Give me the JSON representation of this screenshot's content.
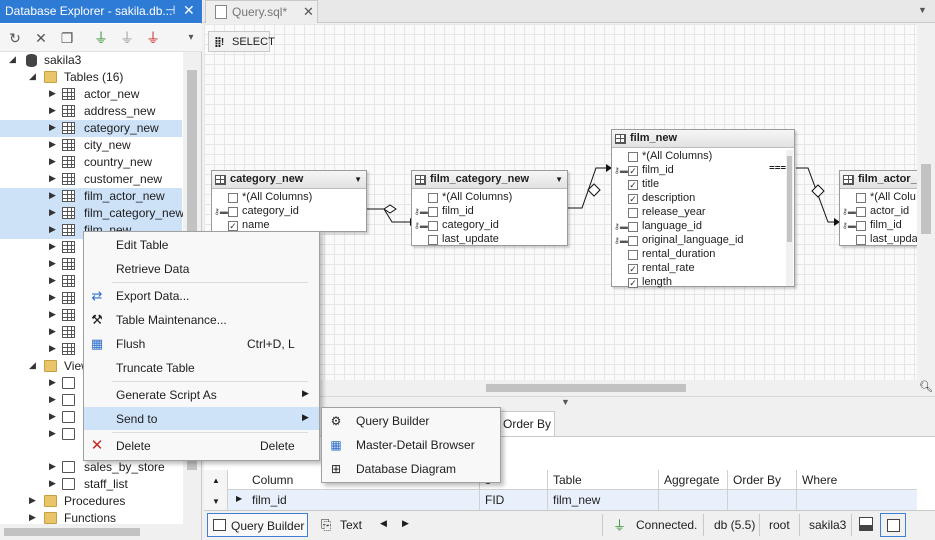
{
  "left_panel": {
    "title": "Database Explorer - sakila.db...",
    "pin_glyph": "⊣",
    "close_glyph": "✕",
    "database": "sakila3",
    "tables_folder": "Tables (16)",
    "tables": [
      "actor_new",
      "address_new",
      "category_new",
      "city_new",
      "country_new",
      "customer_new",
      "film_actor_new",
      "film_category_new",
      "film_new"
    ],
    "views_folder_partial": "View",
    "views": [
      "sales_by_store",
      "staff_list"
    ],
    "procedures": "Procedures",
    "functions": "Functions"
  },
  "editor": {
    "tab_label": "Query.sql*",
    "select_button": "SELECT"
  },
  "diagram": {
    "category_new": {
      "name": "category_new",
      "columns": [
        "*(All Columns)",
        "category_id",
        "name"
      ]
    },
    "film_category_new": {
      "name": "film_category_new",
      "columns": [
        "*(All Columns)",
        "film_id",
        "category_id",
        "last_update"
      ]
    },
    "film_new": {
      "name": "film_new",
      "columns": [
        "*(All Columns)",
        "film_id",
        "title",
        "description",
        "release_year",
        "language_id",
        "original_language_id",
        "rental_duration",
        "rental_rate",
        "length"
      ]
    },
    "film_actor_new": {
      "name": "film_actor_",
      "columns": [
        "*(All Colu",
        "actor_id",
        "film_id",
        "last_updat"
      ]
    }
  },
  "context_menu": {
    "items": [
      {
        "label": "Edit Table",
        "accel": "E"
      },
      {
        "label": "Retrieve Data",
        "accel": "R"
      },
      {
        "label": "Export Data...",
        "accel": "E"
      },
      {
        "label": "Table Maintenance...",
        "accel": "M"
      },
      {
        "label": "Flush",
        "accel": "F",
        "shortcut": "Ctrl+D, L"
      },
      {
        "label": "Truncate Table",
        "accel": "T"
      },
      {
        "label": "Generate Script As",
        "accel": "S"
      },
      {
        "label": "Send to",
        "accel": "S"
      },
      {
        "label": "Delete",
        "accel": "D",
        "shortcut": "Delete"
      }
    ]
  },
  "submenu": {
    "items": [
      "Query Builder",
      "Master-Detail Browser",
      "Database Diagram"
    ]
  },
  "query_grid": {
    "tab_label": "Order By",
    "headers": [
      "Column",
      "s",
      "Table",
      "Aggregate",
      "Order By",
      "Where"
    ],
    "row": [
      "film_id",
      "FID",
      "film_new"
    ]
  },
  "status_bar": {
    "query_builder": "Query Builder",
    "text": "Text",
    "connected": "Connected.",
    "db": "db (5.5)",
    "user": "root",
    "database": "sakila3"
  },
  "colors": {
    "accent": "#2d7bd4",
    "selection": "#cde1f7",
    "menu_highlight": "#cfe3f8"
  }
}
